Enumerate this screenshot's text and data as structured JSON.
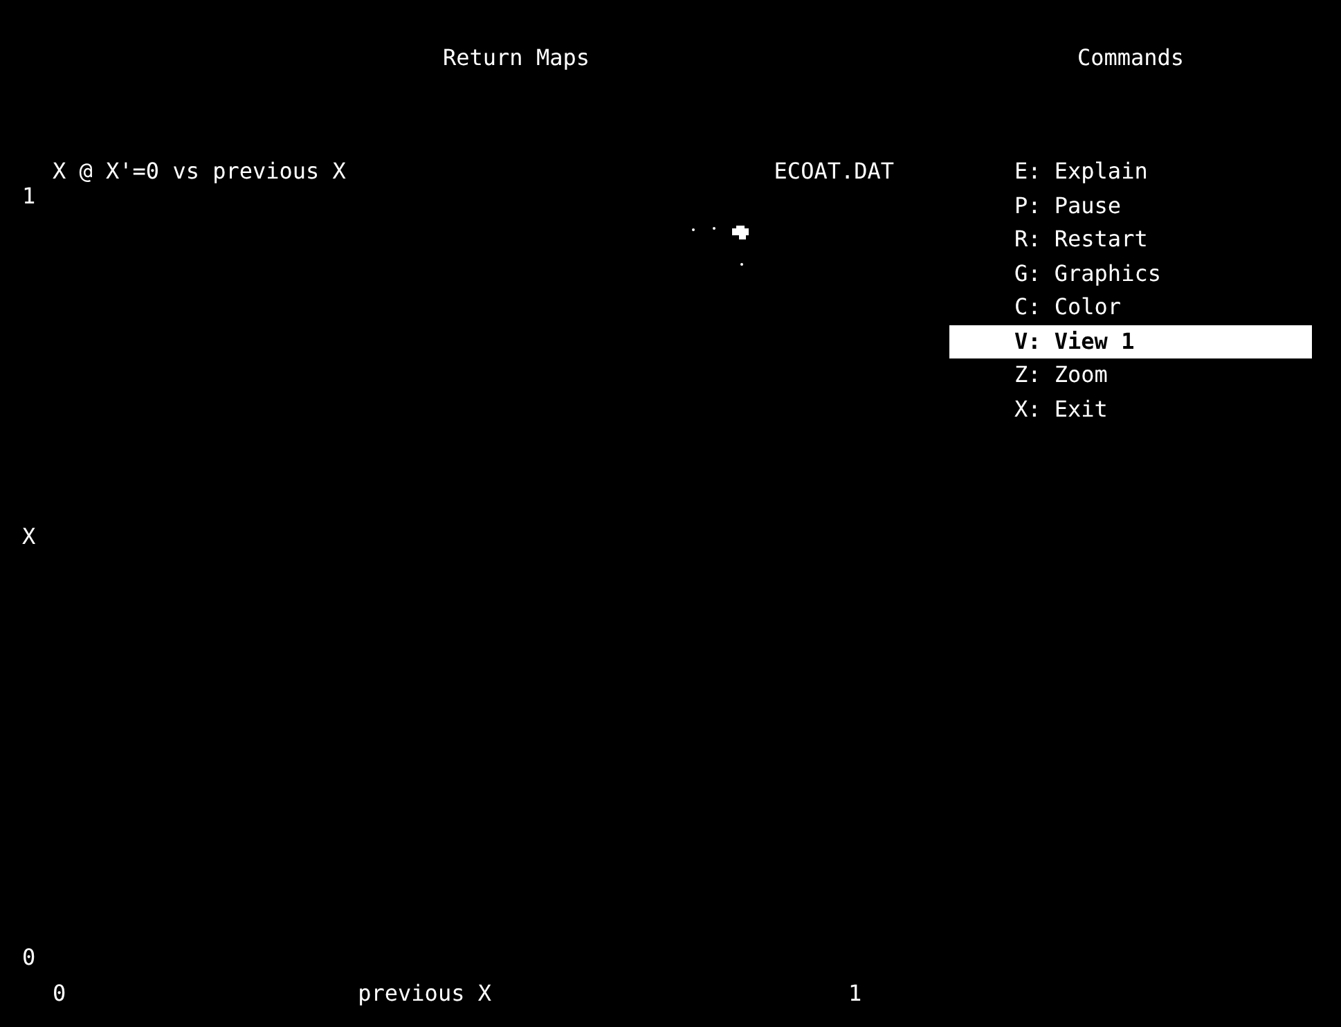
{
  "plot": {
    "title": "Return Maps",
    "subtitle": "X @ X'=0 vs previous X",
    "file": "ECOAT.DAT",
    "y_max": "1",
    "ylabel": "X",
    "y_min": "0",
    "x_min": "0",
    "xlabel": "previous X",
    "x_max": "1"
  },
  "commands": {
    "title": "Commands",
    "items": [
      {
        "label": "E: Explain",
        "selected": false
      },
      {
        "label": "P: Pause",
        "selected": false
      },
      {
        "label": "R: Restart",
        "selected": false
      },
      {
        "label": "G: Graphics",
        "selected": false
      },
      {
        "label": "C: Color",
        "selected": false
      },
      {
        "label": "V: View 1",
        "selected": true
      },
      {
        "label": "Z: Zoom",
        "selected": false
      },
      {
        "label": "X: Exit",
        "selected": false
      }
    ]
  }
}
